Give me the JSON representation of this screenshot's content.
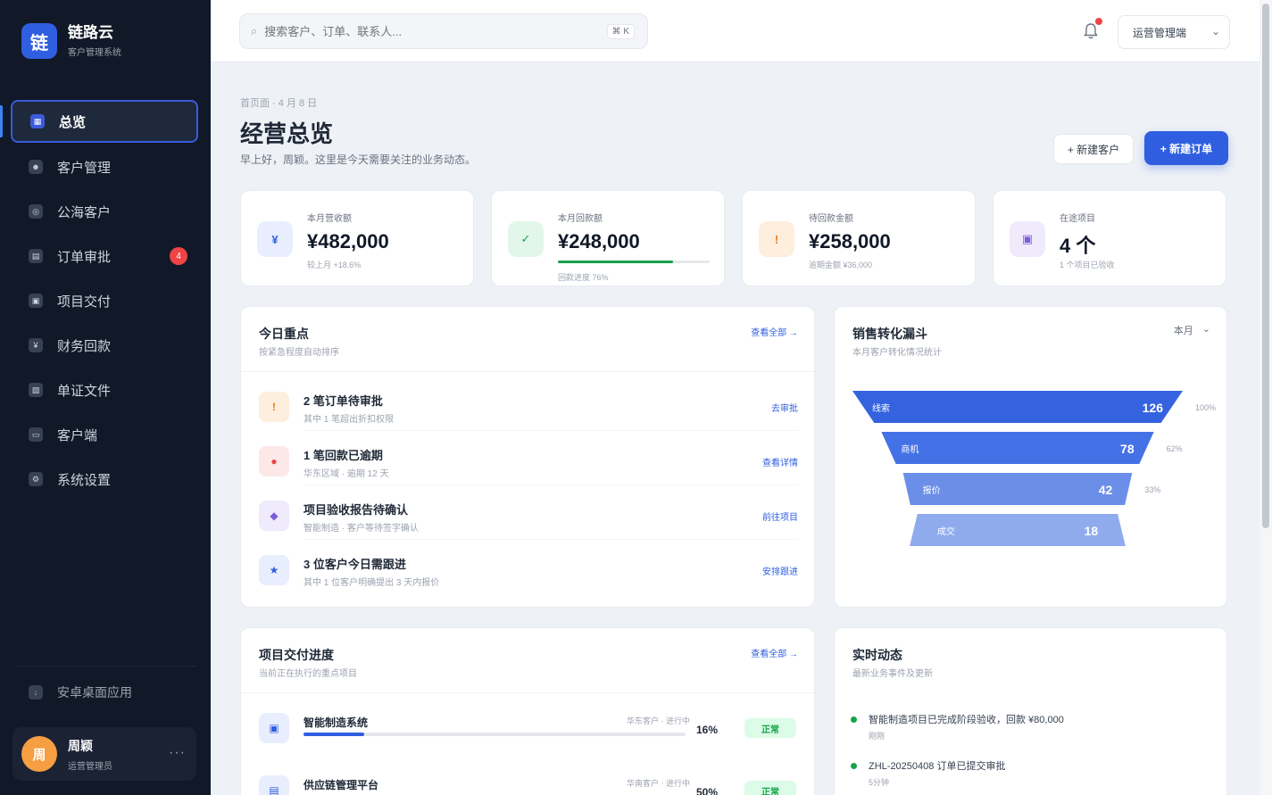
{
  "brand": {
    "logo_letter": "链",
    "name": "链路云",
    "subtitle": "客户管理系统"
  },
  "sidebar": {
    "items": [
      {
        "label": "总览",
        "icon": "dashboard-icon",
        "glyph": "▦",
        "active": true
      },
      {
        "label": "客户管理",
        "icon": "users-icon",
        "glyph": "☻"
      },
      {
        "label": "公海客户",
        "icon": "globe-icon",
        "glyph": "◎"
      },
      {
        "label": "订单审批",
        "icon": "clipboard-icon",
        "glyph": "▤",
        "badge": "4"
      },
      {
        "label": "项目交付",
        "icon": "box-icon",
        "glyph": "▣"
      },
      {
        "label": "财务回款",
        "icon": "wallet-icon",
        "glyph": "¥"
      },
      {
        "label": "单证文件",
        "icon": "file-icon",
        "glyph": "▧"
      },
      {
        "label": "客户端",
        "icon": "monitor-icon",
        "glyph": "▭"
      },
      {
        "label": "系统设置",
        "icon": "gear-icon",
        "glyph": "⚙"
      }
    ],
    "download_label": "安卓桌面应用",
    "user": {
      "avatar_letter": "周",
      "name": "周颖",
      "role": "运营管理员",
      "more": "···"
    }
  },
  "topbar": {
    "search_placeholder": "搜索客户、订单、联系人...",
    "search_shortcut": "⌘ K",
    "workspace": "运营管理端"
  },
  "header": {
    "breadcrumb": "首页面 · 4 月 8 日",
    "title": "经营总览",
    "subtitle": "早上好，周颖。这里是今天需要关注的业务动态。",
    "secondary_button": "+ 新建客户",
    "primary_button": "+ 新建订单"
  },
  "kpis": [
    {
      "label": "本月营收额",
      "value": "¥482,000",
      "foot": "较上月 +18.6%",
      "glyph": "¥",
      "color": "#2f5fe0",
      "bg": "#e8eefd"
    },
    {
      "label": "本月回款额",
      "value": "¥248,000",
      "foot": "回款进度 76%",
      "glyph": "✓",
      "color": "#16a34a",
      "bg": "#e3f6ea",
      "progress": 0.76
    },
    {
      "label": "待回款金额",
      "value": "¥258,000",
      "foot": "逾期金额 ¥36,000",
      "glyph": "!",
      "color": "#ea7a1a",
      "bg": "#fdeedd"
    },
    {
      "label": "在途项目",
      "value": "4 个",
      "foot": "1 个项目已验收",
      "glyph": "▣",
      "color": "#7c5cdb",
      "bg": "#efeafc"
    }
  ],
  "todo_panel": {
    "title": "今日重点",
    "subtitle": "按紧急程度自动排序",
    "link": "查看全部 →",
    "items": [
      {
        "title": "2 笔订单待审批",
        "desc": "其中 1 笔超出折扣权限",
        "action": "去审批",
        "glyph": "!",
        "color": "#ea7a1a",
        "bg": "#fdeedd"
      },
      {
        "title": "1 笔回款已逾期",
        "desc": "华东区域 · 逾期 12 天",
        "action": "查看详情",
        "glyph": "●",
        "color": "#ef4444",
        "bg": "#fde8e8"
      },
      {
        "title": "项目验收报告待确认",
        "desc": "智能制造 · 客户等待签字确认",
        "action": "前往项目",
        "glyph": "◆",
        "color": "#7c5cdb",
        "bg": "#efeafc"
      },
      {
        "title": "3 位客户今日需跟进",
        "desc": "其中 1 位客户明确提出 3 天内报价",
        "action": "安排跟进",
        "glyph": "★",
        "color": "#2f5fe0",
        "bg": "#e8eefd"
      }
    ]
  },
  "funnel_panel": {
    "title": "销售转化漏斗",
    "subtitle": "本月客户转化情况统计",
    "period": "本月",
    "chevron": "⌄",
    "stages": [
      {
        "name": "线索",
        "value": 126,
        "rate": "100%"
      },
      {
        "name": "商机",
        "value": 78,
        "rate": "62%"
      },
      {
        "name": "报价",
        "value": 42,
        "rate": "33%"
      },
      {
        "name": "成交",
        "value": 18,
        "rate": ""
      }
    ]
  },
  "projects_panel": {
    "title": "项目交付进度",
    "subtitle": "当前正在执行的重点项目",
    "link": "查看全部 →",
    "items": [
      {
        "name": "智能制造系统",
        "meta": "华东客户 · 进行中",
        "progress": 0.16,
        "pct": "16%",
        "status": "正常",
        "glyph": "▣"
      },
      {
        "name": "供应链管理平台",
        "meta": "华南客户 · 进行中",
        "progress": 0.5,
        "pct": "50%",
        "status": "正常",
        "glyph": "▤"
      }
    ]
  },
  "activity_panel": {
    "title": "实时动态",
    "subtitle": "最新业务事件及更新",
    "items": [
      {
        "text": "智能制造项目已完成阶段验收，回款 ¥80,000",
        "time": "刚刚"
      },
      {
        "text": "ZHL-20250408 订单已提交审批",
        "time": "5分钟"
      }
    ]
  }
}
